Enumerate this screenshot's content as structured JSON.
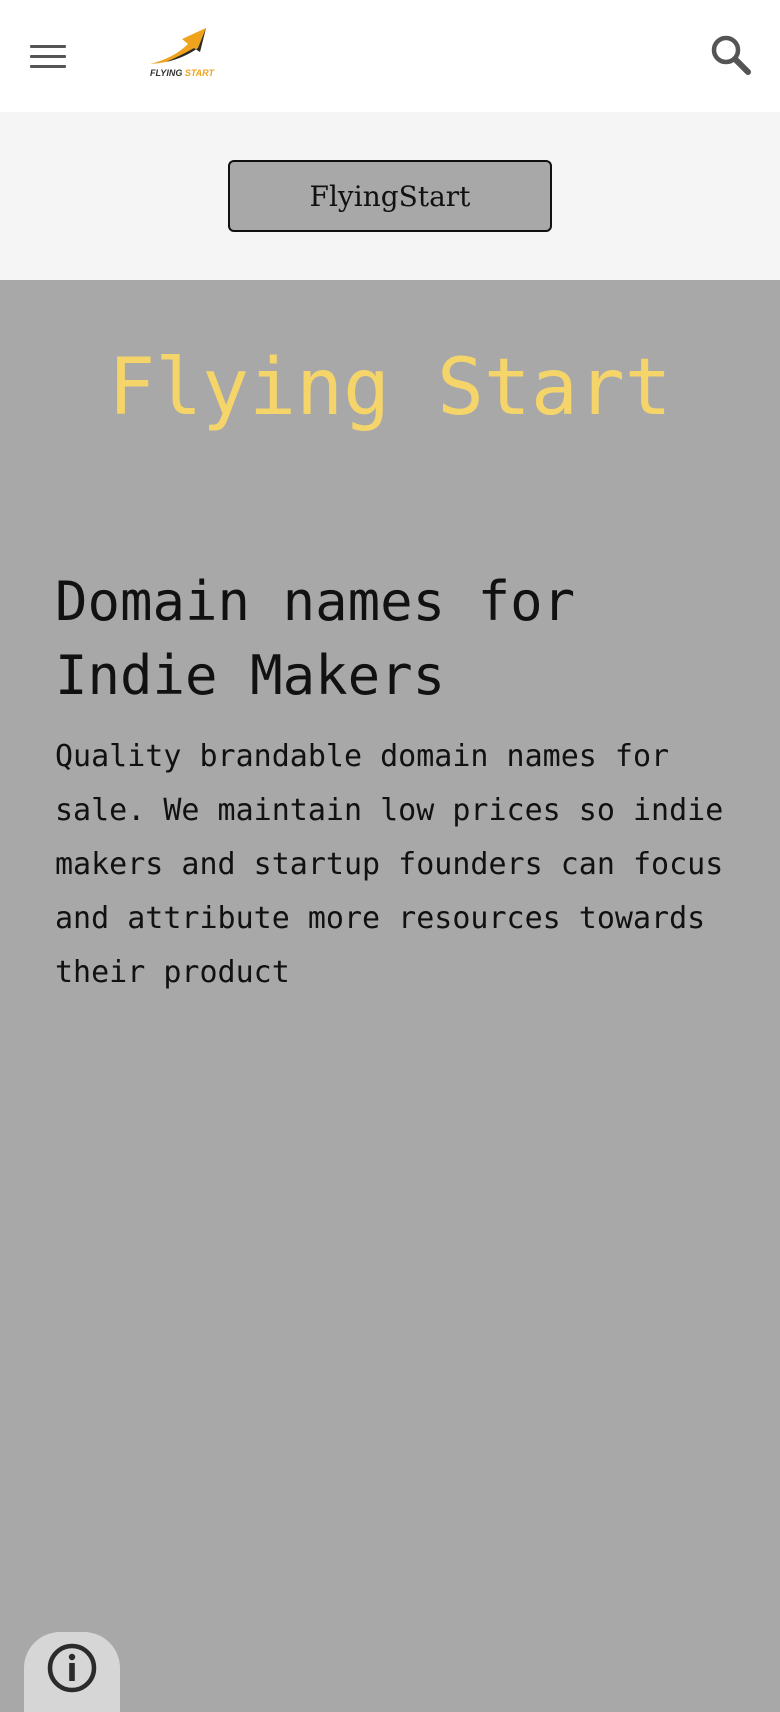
{
  "header": {
    "menu_icon": "hamburger-menu-icon",
    "logo": {
      "text_main": "FLYING",
      "text_accent": "START",
      "accent_color": "#f0a31c"
    },
    "search_icon": "search-icon"
  },
  "subbar": {
    "button_label": "FlyingStart"
  },
  "hero": {
    "title": "Flying Start",
    "title_color": "#f5d56a"
  },
  "content": {
    "headline": "Domain names for Indie Makers",
    "body": "Quality brandable domain names for sale. We maintain low prices so indie makers and startup founders can focus and attribute more resources towards their product"
  },
  "footer": {
    "info_icon": "info-icon"
  },
  "colors": {
    "page_background": "#a8a8a8",
    "subbar_background": "#f5f5f5",
    "header_background": "#ffffff"
  }
}
